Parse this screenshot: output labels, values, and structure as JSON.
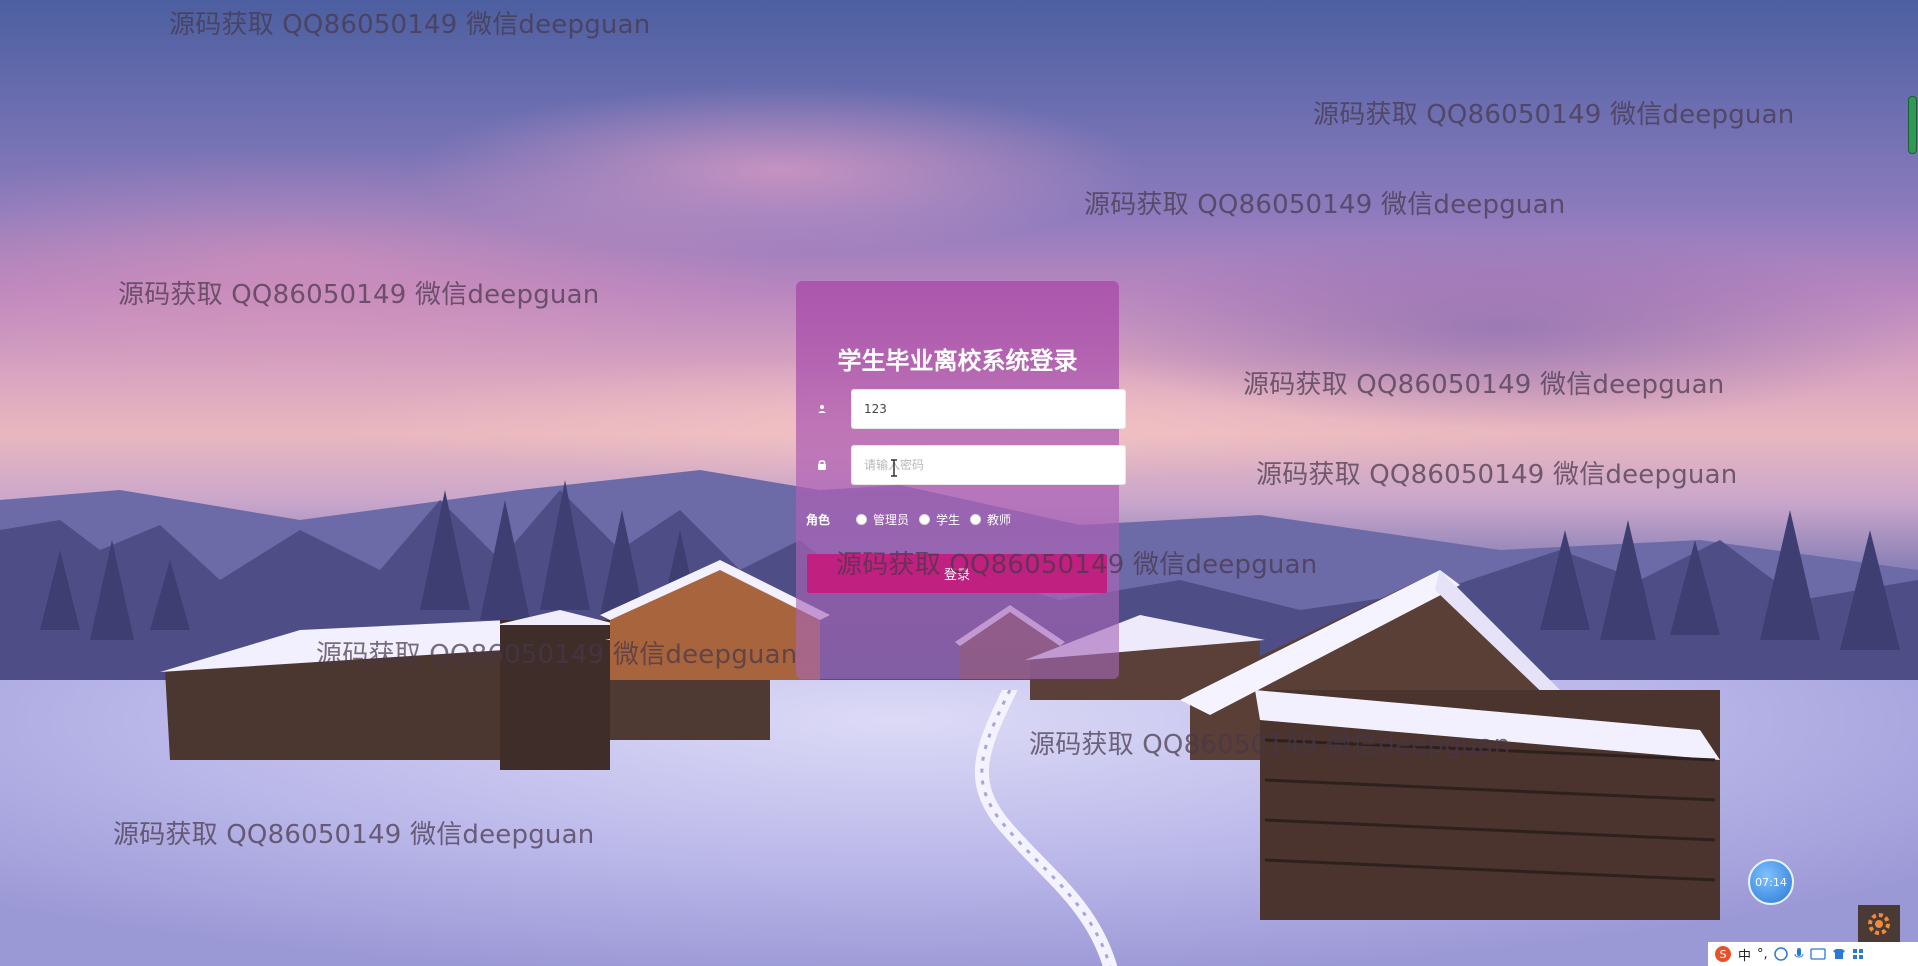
{
  "login": {
    "title": "学生毕业离校系统登录",
    "username_value": "123",
    "password_placeholder": "请输入密码",
    "role_label": "角色",
    "roles": [
      "管理员",
      "学生",
      "教师"
    ],
    "submit_label": "登录"
  },
  "watermark_text": "源码获取 QQ86050149 微信deepguan",
  "overlays": {
    "timer": "07:14",
    "ime_language": "中"
  },
  "icons": {
    "user": "user-icon",
    "lock": "lock-icon",
    "gear": "gear-icon",
    "sogou": "sogou-input-icon"
  },
  "colors": {
    "card": "#b05cb3",
    "button": "#c0207f",
    "timer": "#2a79d6"
  }
}
